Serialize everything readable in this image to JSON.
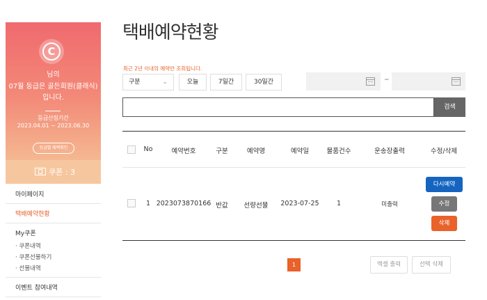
{
  "sidebar": {
    "grade_lines": [
      "님의",
      "07월 등급은 골든회원(클래식)",
      "입니다."
    ],
    "period_label": "등급산정기간",
    "period_value": "2023.04.01 ~ 2023.06.30",
    "benefit_button": "등급별 혜택확인",
    "coupon_label": "쿠폰 : 3",
    "menu": {
      "mypage": "마이페이지",
      "reservation_status": "택배예약현황",
      "my_coupon": "My쿠폰",
      "coupon_list": "· 쿠폰내역",
      "coupon_gift": "· 쿠폰선물하기",
      "gift_list": "· 선물내역",
      "event": "이벤트 참여내역"
    }
  },
  "main": {
    "title": "택배예약현황",
    "notice": "최근 2년 이내의 예약만 조회됩니다.",
    "filter": {
      "select_value": "구분",
      "today": "오늘",
      "days7": "7일간",
      "days30": "30일간",
      "tilde": "~",
      "search_button": "검색"
    },
    "table": {
      "headers": [
        "No",
        "예약번호",
        "구분",
        "예약명",
        "예약일",
        "물품건수",
        "운송장출력",
        "수정/삭제"
      ],
      "rows": [
        {
          "no": "1",
          "reservation_no": "2023073870166",
          "type": "반값",
          "name": "선량선물",
          "date": "2023-07-25",
          "item_count": "1",
          "waybill": "미출력",
          "buttons": {
            "re_reserve": "다시예약",
            "edit": "수정",
            "delete": "삭제"
          }
        }
      ]
    },
    "pagination": {
      "current": "1"
    },
    "excel_button": "엑셀 출력",
    "delete_selected_button": "선택 삭제"
  },
  "colors": {
    "accent": "#e8622a",
    "blue": "#1565c0",
    "gray_button": "#777777",
    "coupon_bar": "#f6c79e"
  }
}
